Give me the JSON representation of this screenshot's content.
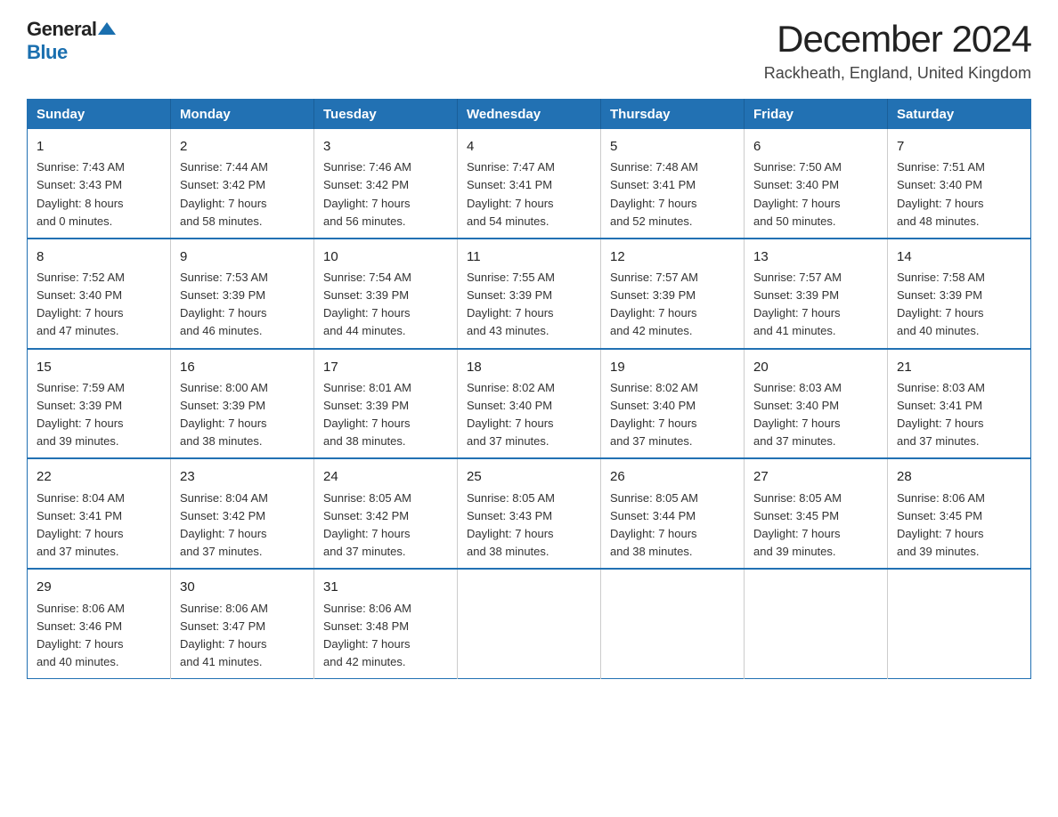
{
  "header": {
    "logo_general": "General",
    "logo_blue": "Blue",
    "title": "December 2024",
    "location": "Rackheath, England, United Kingdom"
  },
  "days_of_week": [
    "Sunday",
    "Monday",
    "Tuesday",
    "Wednesday",
    "Thursday",
    "Friday",
    "Saturday"
  ],
  "weeks": [
    [
      {
        "day": "1",
        "info": "Sunrise: 7:43 AM\nSunset: 3:43 PM\nDaylight: 8 hours\nand 0 minutes."
      },
      {
        "day": "2",
        "info": "Sunrise: 7:44 AM\nSunset: 3:42 PM\nDaylight: 7 hours\nand 58 minutes."
      },
      {
        "day": "3",
        "info": "Sunrise: 7:46 AM\nSunset: 3:42 PM\nDaylight: 7 hours\nand 56 minutes."
      },
      {
        "day": "4",
        "info": "Sunrise: 7:47 AM\nSunset: 3:41 PM\nDaylight: 7 hours\nand 54 minutes."
      },
      {
        "day": "5",
        "info": "Sunrise: 7:48 AM\nSunset: 3:41 PM\nDaylight: 7 hours\nand 52 minutes."
      },
      {
        "day": "6",
        "info": "Sunrise: 7:50 AM\nSunset: 3:40 PM\nDaylight: 7 hours\nand 50 minutes."
      },
      {
        "day": "7",
        "info": "Sunrise: 7:51 AM\nSunset: 3:40 PM\nDaylight: 7 hours\nand 48 minutes."
      }
    ],
    [
      {
        "day": "8",
        "info": "Sunrise: 7:52 AM\nSunset: 3:40 PM\nDaylight: 7 hours\nand 47 minutes."
      },
      {
        "day": "9",
        "info": "Sunrise: 7:53 AM\nSunset: 3:39 PM\nDaylight: 7 hours\nand 46 minutes."
      },
      {
        "day": "10",
        "info": "Sunrise: 7:54 AM\nSunset: 3:39 PM\nDaylight: 7 hours\nand 44 minutes."
      },
      {
        "day": "11",
        "info": "Sunrise: 7:55 AM\nSunset: 3:39 PM\nDaylight: 7 hours\nand 43 minutes."
      },
      {
        "day": "12",
        "info": "Sunrise: 7:57 AM\nSunset: 3:39 PM\nDaylight: 7 hours\nand 42 minutes."
      },
      {
        "day": "13",
        "info": "Sunrise: 7:57 AM\nSunset: 3:39 PM\nDaylight: 7 hours\nand 41 minutes."
      },
      {
        "day": "14",
        "info": "Sunrise: 7:58 AM\nSunset: 3:39 PM\nDaylight: 7 hours\nand 40 minutes."
      }
    ],
    [
      {
        "day": "15",
        "info": "Sunrise: 7:59 AM\nSunset: 3:39 PM\nDaylight: 7 hours\nand 39 minutes."
      },
      {
        "day": "16",
        "info": "Sunrise: 8:00 AM\nSunset: 3:39 PM\nDaylight: 7 hours\nand 38 minutes."
      },
      {
        "day": "17",
        "info": "Sunrise: 8:01 AM\nSunset: 3:39 PM\nDaylight: 7 hours\nand 38 minutes."
      },
      {
        "day": "18",
        "info": "Sunrise: 8:02 AM\nSunset: 3:40 PM\nDaylight: 7 hours\nand 37 minutes."
      },
      {
        "day": "19",
        "info": "Sunrise: 8:02 AM\nSunset: 3:40 PM\nDaylight: 7 hours\nand 37 minutes."
      },
      {
        "day": "20",
        "info": "Sunrise: 8:03 AM\nSunset: 3:40 PM\nDaylight: 7 hours\nand 37 minutes."
      },
      {
        "day": "21",
        "info": "Sunrise: 8:03 AM\nSunset: 3:41 PM\nDaylight: 7 hours\nand 37 minutes."
      }
    ],
    [
      {
        "day": "22",
        "info": "Sunrise: 8:04 AM\nSunset: 3:41 PM\nDaylight: 7 hours\nand 37 minutes."
      },
      {
        "day": "23",
        "info": "Sunrise: 8:04 AM\nSunset: 3:42 PM\nDaylight: 7 hours\nand 37 minutes."
      },
      {
        "day": "24",
        "info": "Sunrise: 8:05 AM\nSunset: 3:42 PM\nDaylight: 7 hours\nand 37 minutes."
      },
      {
        "day": "25",
        "info": "Sunrise: 8:05 AM\nSunset: 3:43 PM\nDaylight: 7 hours\nand 38 minutes."
      },
      {
        "day": "26",
        "info": "Sunrise: 8:05 AM\nSunset: 3:44 PM\nDaylight: 7 hours\nand 38 minutes."
      },
      {
        "day": "27",
        "info": "Sunrise: 8:05 AM\nSunset: 3:45 PM\nDaylight: 7 hours\nand 39 minutes."
      },
      {
        "day": "28",
        "info": "Sunrise: 8:06 AM\nSunset: 3:45 PM\nDaylight: 7 hours\nand 39 minutes."
      }
    ],
    [
      {
        "day": "29",
        "info": "Sunrise: 8:06 AM\nSunset: 3:46 PM\nDaylight: 7 hours\nand 40 minutes."
      },
      {
        "day": "30",
        "info": "Sunrise: 8:06 AM\nSunset: 3:47 PM\nDaylight: 7 hours\nand 41 minutes."
      },
      {
        "day": "31",
        "info": "Sunrise: 8:06 AM\nSunset: 3:48 PM\nDaylight: 7 hours\nand 42 minutes."
      },
      null,
      null,
      null,
      null
    ]
  ]
}
